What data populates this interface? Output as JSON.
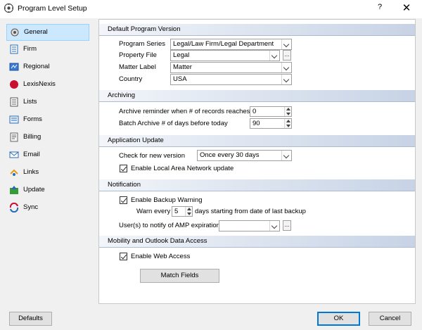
{
  "window": {
    "title": "Program Level Setup",
    "help_label": "?",
    "close_label": "✕"
  },
  "nav": {
    "items": [
      {
        "label": "General",
        "icon": "gear-icon"
      },
      {
        "label": "Firm",
        "icon": "document-icon"
      },
      {
        "label": "Regional",
        "icon": "map-icon"
      },
      {
        "label": "LexisNexis",
        "icon": "lexisnexis-icon"
      },
      {
        "label": "Lists",
        "icon": "list-icon"
      },
      {
        "label": "Forms",
        "icon": "form-icon"
      },
      {
        "label": "Billing",
        "icon": "billing-icon"
      },
      {
        "label": "Email",
        "icon": "email-icon"
      },
      {
        "label": "Links",
        "icon": "link-icon"
      },
      {
        "label": "Update",
        "icon": "update-icon"
      },
      {
        "label": "Sync",
        "icon": "sync-icon"
      }
    ],
    "selected": "General"
  },
  "default_program_version": {
    "header": "Default Program Version",
    "program_series_label": "Program Series",
    "program_series_value": "Legal/Law Firm/Legal Department",
    "property_file_label": "Property File",
    "property_file_value": "Legal",
    "ellipsis": "...",
    "matter_label_label": "Matter Label",
    "matter_label_value": "Matter",
    "country_label": "Country",
    "country_value": "USA"
  },
  "archiving": {
    "header": "Archiving",
    "reminder_label": "Archive reminder when # of records reaches",
    "reminder_value": "0",
    "batch_label": "Batch Archive # of days before today",
    "batch_value": "90"
  },
  "application_update": {
    "header": "Application Update",
    "check_label": "Check for new version",
    "check_value": "Once every 30 days",
    "lan_label": "Enable Local Area Network update",
    "lan_checked": true
  },
  "notification": {
    "header": "Notification",
    "backup_label": "Enable Backup Warning",
    "backup_checked": true,
    "warn_prefix": "Warn every",
    "warn_value": "5",
    "warn_suffix": "days starting from date of last backup",
    "notify_label": "User(s) to notify of AMP expiration",
    "notify_value": "",
    "ellipsis": "..."
  },
  "mobility": {
    "header": "Mobility and Outlook Data Access",
    "web_access_label": "Enable Web Access",
    "web_access_checked": true,
    "match_fields_label": "Match Fields"
  },
  "footer": {
    "defaults_label": "Defaults",
    "ok_label": "OK",
    "cancel_label": "Cancel"
  },
  "colors": {
    "selection": "#cce8ff",
    "header_gradient_end": "#c7d3e5",
    "accent": "#0078d7"
  }
}
